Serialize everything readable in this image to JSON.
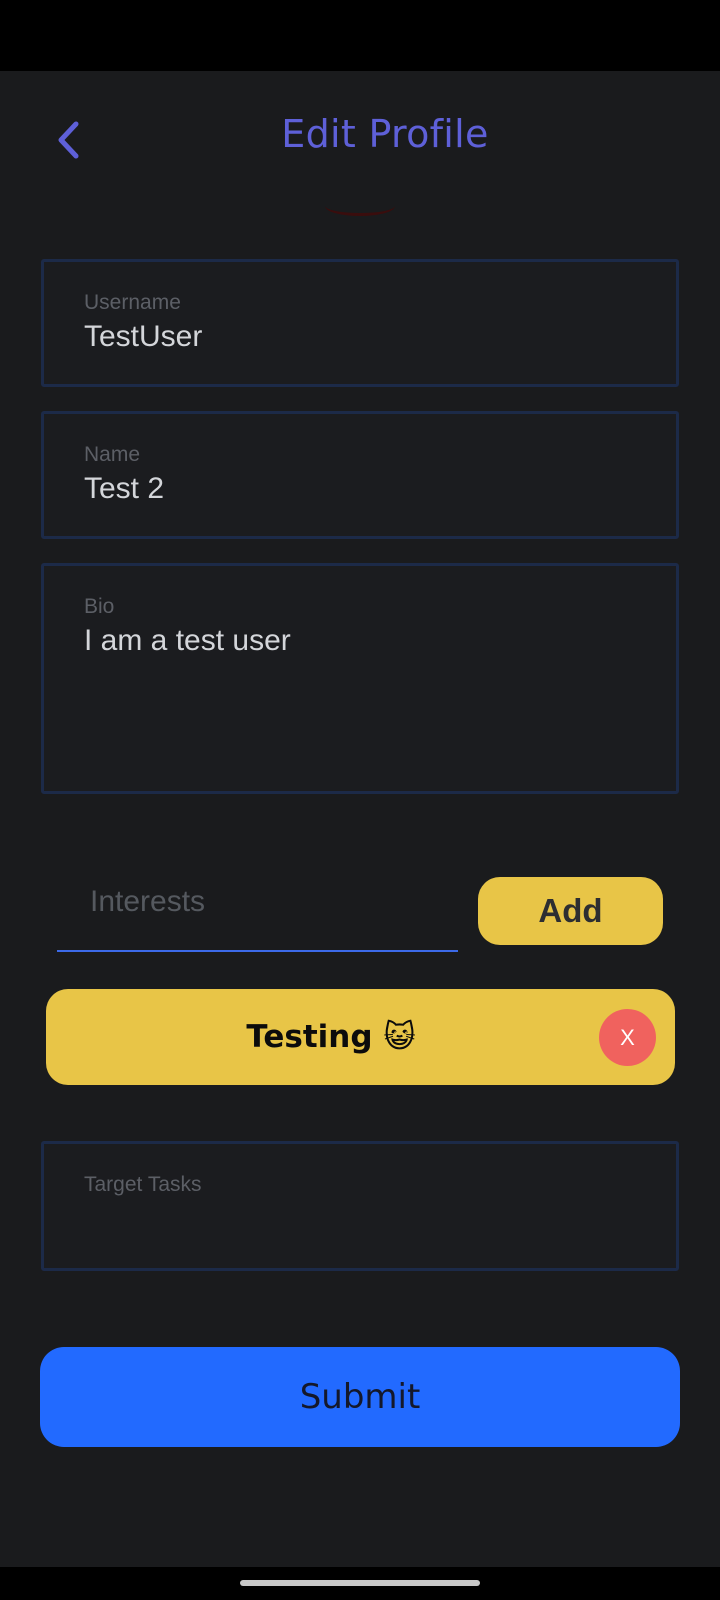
{
  "header": {
    "title": "Edit Profile",
    "back_icon": "chevron-left-icon",
    "accent_color": "#5e60d8"
  },
  "form": {
    "username": {
      "label": "Username",
      "value": "TestUser"
    },
    "name": {
      "label": "Name",
      "value": "Test 2"
    },
    "bio": {
      "label": "Bio",
      "value": "I am a test user"
    },
    "interests": {
      "placeholder": "Interests",
      "add_label": "Add",
      "chips": [
        {
          "label": "Testing 😺",
          "remove_label": "X"
        }
      ]
    },
    "target_tasks": {
      "label": "Target Tasks",
      "value": ""
    },
    "submit_label": "Submit"
  },
  "colors": {
    "background": "#1a1b1d",
    "chip": "#e8c547",
    "remove": "#f0625e",
    "submit": "#226aff"
  }
}
